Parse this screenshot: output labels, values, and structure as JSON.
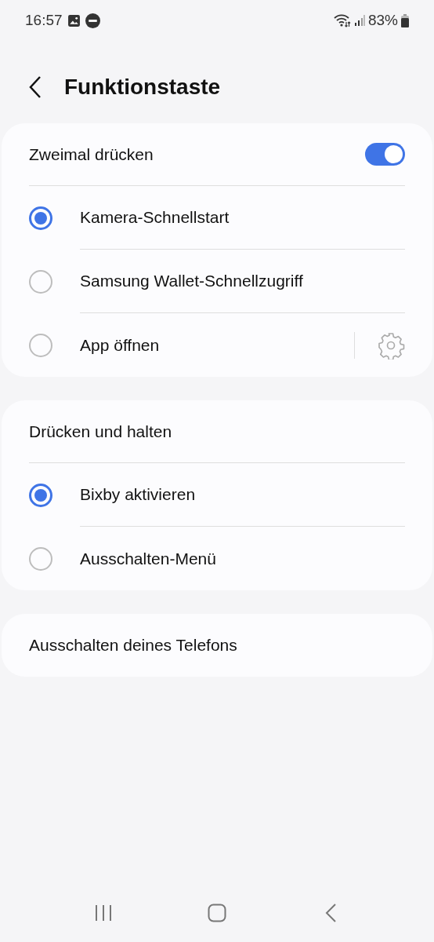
{
  "status_bar": {
    "time": "16:57",
    "battery": "83%"
  },
  "header": {
    "title": "Funktionstaste"
  },
  "sections": [
    {
      "title": "Zweimal drücken",
      "toggle": {
        "on": true
      },
      "options": [
        {
          "label": "Kamera-Schnellstart",
          "selected": true,
          "settings": false
        },
        {
          "label": "Samsung Wallet-Schnellzugriff",
          "selected": false,
          "settings": false
        },
        {
          "label": "App öffnen",
          "selected": false,
          "settings": true
        }
      ]
    },
    {
      "title": "Drücken und halten",
      "options": [
        {
          "label": "Bixby aktivieren",
          "selected": true,
          "settings": false
        },
        {
          "label": "Ausschalten-Menü",
          "selected": false,
          "settings": false
        }
      ]
    },
    {
      "title": "Ausschalten deines Telefons"
    }
  ]
}
